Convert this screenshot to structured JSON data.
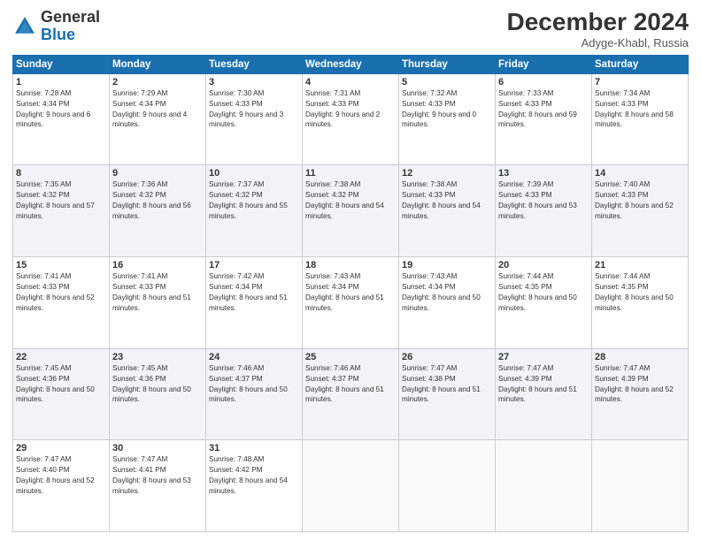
{
  "header": {
    "logo_general": "General",
    "logo_blue": "Blue",
    "month_year": "December 2024",
    "location": "Adyge-Khabl, Russia"
  },
  "days_of_week": [
    "Sunday",
    "Monday",
    "Tuesday",
    "Wednesday",
    "Thursday",
    "Friday",
    "Saturday"
  ],
  "weeks": [
    [
      {
        "day": "1",
        "info": "Sunrise: 7:28 AM\nSunset: 4:34 PM\nDaylight: 9 hours and 6 minutes."
      },
      {
        "day": "2",
        "info": "Sunrise: 7:29 AM\nSunset: 4:34 PM\nDaylight: 9 hours and 4 minutes."
      },
      {
        "day": "3",
        "info": "Sunrise: 7:30 AM\nSunset: 4:33 PM\nDaylight: 9 hours and 3 minutes."
      },
      {
        "day": "4",
        "info": "Sunrise: 7:31 AM\nSunset: 4:33 PM\nDaylight: 9 hours and 2 minutes."
      },
      {
        "day": "5",
        "info": "Sunrise: 7:32 AM\nSunset: 4:33 PM\nDaylight: 9 hours and 0 minutes."
      },
      {
        "day": "6",
        "info": "Sunrise: 7:33 AM\nSunset: 4:33 PM\nDaylight: 8 hours and 59 minutes."
      },
      {
        "day": "7",
        "info": "Sunrise: 7:34 AM\nSunset: 4:33 PM\nDaylight: 8 hours and 58 minutes."
      }
    ],
    [
      {
        "day": "8",
        "info": "Sunrise: 7:35 AM\nSunset: 4:32 PM\nDaylight: 8 hours and 57 minutes."
      },
      {
        "day": "9",
        "info": "Sunrise: 7:36 AM\nSunset: 4:32 PM\nDaylight: 8 hours and 56 minutes."
      },
      {
        "day": "10",
        "info": "Sunrise: 7:37 AM\nSunset: 4:32 PM\nDaylight: 8 hours and 55 minutes."
      },
      {
        "day": "11",
        "info": "Sunrise: 7:38 AM\nSunset: 4:32 PM\nDaylight: 8 hours and 54 minutes."
      },
      {
        "day": "12",
        "info": "Sunrise: 7:38 AM\nSunset: 4:33 PM\nDaylight: 8 hours and 54 minutes."
      },
      {
        "day": "13",
        "info": "Sunrise: 7:39 AM\nSunset: 4:33 PM\nDaylight: 8 hours and 53 minutes."
      },
      {
        "day": "14",
        "info": "Sunrise: 7:40 AM\nSunset: 4:33 PM\nDaylight: 8 hours and 52 minutes."
      }
    ],
    [
      {
        "day": "15",
        "info": "Sunrise: 7:41 AM\nSunset: 4:33 PM\nDaylight: 8 hours and 52 minutes."
      },
      {
        "day": "16",
        "info": "Sunrise: 7:41 AM\nSunset: 4:33 PM\nDaylight: 8 hours and 51 minutes."
      },
      {
        "day": "17",
        "info": "Sunrise: 7:42 AM\nSunset: 4:34 PM\nDaylight: 8 hours and 51 minutes."
      },
      {
        "day": "18",
        "info": "Sunrise: 7:43 AM\nSunset: 4:34 PM\nDaylight: 8 hours and 51 minutes."
      },
      {
        "day": "19",
        "info": "Sunrise: 7:43 AM\nSunset: 4:34 PM\nDaylight: 8 hours and 50 minutes."
      },
      {
        "day": "20",
        "info": "Sunrise: 7:44 AM\nSunset: 4:35 PM\nDaylight: 8 hours and 50 minutes."
      },
      {
        "day": "21",
        "info": "Sunrise: 7:44 AM\nSunset: 4:35 PM\nDaylight: 8 hours and 50 minutes."
      }
    ],
    [
      {
        "day": "22",
        "info": "Sunrise: 7:45 AM\nSunset: 4:36 PM\nDaylight: 8 hours and 50 minutes."
      },
      {
        "day": "23",
        "info": "Sunrise: 7:45 AM\nSunset: 4:36 PM\nDaylight: 8 hours and 50 minutes."
      },
      {
        "day": "24",
        "info": "Sunrise: 7:46 AM\nSunset: 4:37 PM\nDaylight: 8 hours and 50 minutes."
      },
      {
        "day": "25",
        "info": "Sunrise: 7:46 AM\nSunset: 4:37 PM\nDaylight: 8 hours and 51 minutes."
      },
      {
        "day": "26",
        "info": "Sunrise: 7:47 AM\nSunset: 4:38 PM\nDaylight: 8 hours and 51 minutes."
      },
      {
        "day": "27",
        "info": "Sunrise: 7:47 AM\nSunset: 4:39 PM\nDaylight: 8 hours and 51 minutes."
      },
      {
        "day": "28",
        "info": "Sunrise: 7:47 AM\nSunset: 4:39 PM\nDaylight: 8 hours and 52 minutes."
      }
    ],
    [
      {
        "day": "29",
        "info": "Sunrise: 7:47 AM\nSunset: 4:40 PM\nDaylight: 8 hours and 52 minutes."
      },
      {
        "day": "30",
        "info": "Sunrise: 7:47 AM\nSunset: 4:41 PM\nDaylight: 8 hours and 53 minutes."
      },
      {
        "day": "31",
        "info": "Sunrise: 7:48 AM\nSunset: 4:42 PM\nDaylight: 8 hours and 54 minutes."
      },
      {
        "day": "",
        "info": ""
      },
      {
        "day": "",
        "info": ""
      },
      {
        "day": "",
        "info": ""
      },
      {
        "day": "",
        "info": ""
      }
    ]
  ]
}
